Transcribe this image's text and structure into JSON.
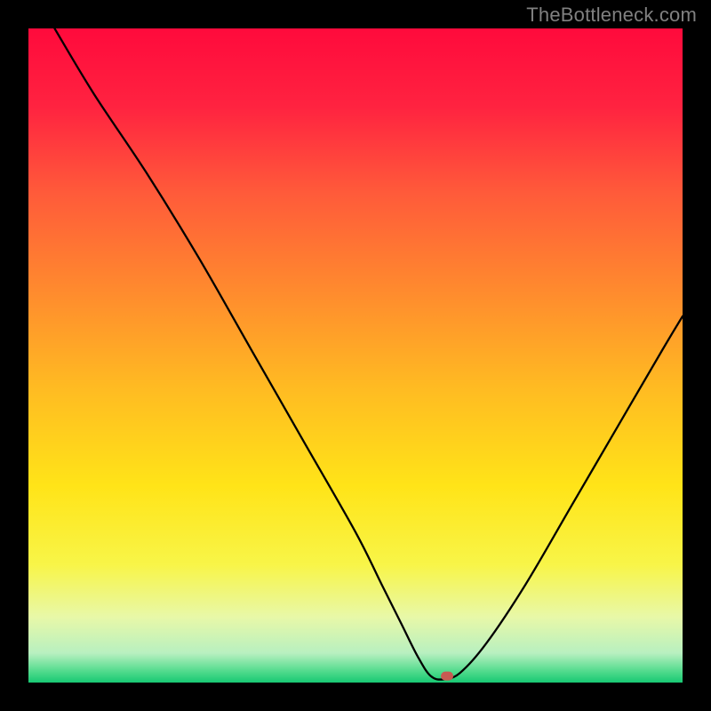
{
  "watermark": "TheBottleneck.com",
  "chart_data": {
    "type": "line",
    "title": "",
    "xlabel": "",
    "ylabel": "",
    "xlim": [
      0,
      100
    ],
    "ylim": [
      0,
      100
    ],
    "x": [
      4,
      10,
      18,
      26,
      34,
      42,
      50,
      54,
      57,
      59.5,
      61.5,
      63.5,
      66,
      70,
      76,
      83,
      90,
      97,
      100
    ],
    "values": [
      100,
      90,
      78,
      65,
      51,
      37,
      23,
      15,
      9,
      4,
      1,
      0.5,
      1.5,
      6,
      15,
      27,
      39,
      51,
      56
    ],
    "marker": {
      "x": 64,
      "y": 1
    },
    "gradient_stops": [
      {
        "offset": 0.0,
        "color": "#ff0a3c"
      },
      {
        "offset": 0.12,
        "color": "#ff2340"
      },
      {
        "offset": 0.25,
        "color": "#ff5a3a"
      },
      {
        "offset": 0.4,
        "color": "#ff8a2e"
      },
      {
        "offset": 0.55,
        "color": "#ffbb22"
      },
      {
        "offset": 0.7,
        "color": "#ffe418"
      },
      {
        "offset": 0.82,
        "color": "#f8f548"
      },
      {
        "offset": 0.9,
        "color": "#e8f8a8"
      },
      {
        "offset": 0.955,
        "color": "#b8f0c0"
      },
      {
        "offset": 0.985,
        "color": "#4ad989"
      },
      {
        "offset": 1.0,
        "color": "#18c873"
      }
    ]
  }
}
